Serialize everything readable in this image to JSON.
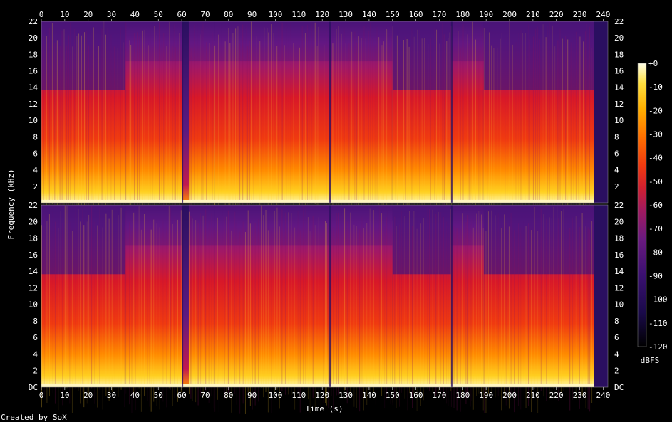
{
  "chart_data": {
    "type": "heatmap",
    "title": "",
    "xlabel": "Time (s)",
    "ylabel": "Frequency (kHz)",
    "xlim": [
      0,
      242
    ],
    "ylim": [
      0,
      22
    ],
    "x_ticks": [
      "0",
      "10",
      "20",
      "30",
      "40",
      "50",
      "60",
      "70",
      "80",
      "90",
      "100",
      "110",
      "120",
      "130",
      "140",
      "150",
      "160",
      "170",
      "180",
      "190",
      "200",
      "210",
      "220",
      "230",
      "240"
    ],
    "y_ticks_top": [
      "2",
      "4",
      "6",
      "8",
      "10",
      "12",
      "14",
      "16",
      "18",
      "20",
      "22"
    ],
    "y_ticks_bottom": [
      "DC",
      "2",
      "4",
      "6",
      "8",
      "10",
      "12",
      "14",
      "16",
      "18",
      "20",
      "22"
    ],
    "channels": 2,
    "colorbar": {
      "label": "dBFS",
      "ticks": [
        "+0",
        "-10",
        "-20",
        "-30",
        "-40",
        "-50",
        "-60",
        "-70",
        "-80",
        "-90",
        "-100",
        "-110",
        "-120"
      ],
      "range": [
        -120,
        0
      ],
      "colors": [
        "#000000",
        "#1a0a4a",
        "#3a1070",
        "#6a1a80",
        "#a01a60",
        "#d02030",
        "#f03a10",
        "#ff7000",
        "#ffb000",
        "#ffe040",
        "#ffffe8"
      ]
    },
    "sections": [
      {
        "start": 0,
        "end": 36,
        "level": "moderate"
      },
      {
        "start": 36,
        "end": 60,
        "level": "loud"
      },
      {
        "start": 60,
        "end": 63,
        "level": "quiet"
      },
      {
        "start": 63,
        "end": 74,
        "level": "loud"
      },
      {
        "start": 74,
        "end": 150,
        "level": "loud"
      },
      {
        "start": 150,
        "end": 175,
        "level": "moderate"
      },
      {
        "start": 175,
        "end": 189,
        "level": "loud"
      },
      {
        "start": 189,
        "end": 236,
        "level": "moderate"
      },
      {
        "start": 236,
        "end": 242,
        "level": "silent"
      }
    ],
    "footer": "Created by SoX"
  }
}
